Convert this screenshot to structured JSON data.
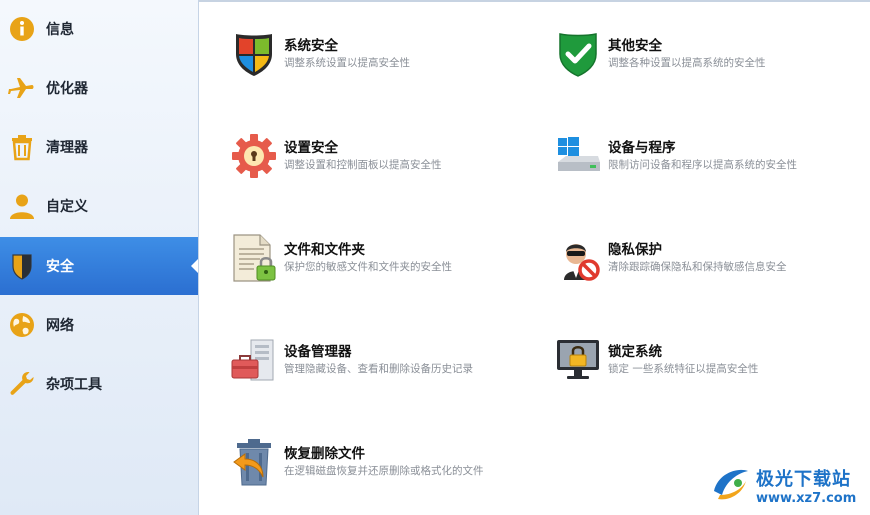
{
  "sidebar": {
    "items": [
      {
        "label": "信息"
      },
      {
        "label": "优化器"
      },
      {
        "label": "清理器"
      },
      {
        "label": "自定义"
      },
      {
        "label": "安全"
      },
      {
        "label": "网络"
      },
      {
        "label": "杂项工具"
      }
    ],
    "active_index": 4
  },
  "main": {
    "tiles": [
      {
        "title": "系统安全",
        "desc": "调整系统设置以提高安全性"
      },
      {
        "title": "其他安全",
        "desc": "调整各种设置以提高系统的安全性"
      },
      {
        "title": "设置安全",
        "desc": "调整设置和控制面板以提高安全性"
      },
      {
        "title": "设备与程序",
        "desc": "限制访问设备和程序以提高系统的安全性"
      },
      {
        "title": "文件和文件夹",
        "desc": "保护您的敏感文件和文件夹的安全性"
      },
      {
        "title": "隐私保护",
        "desc": "清除跟踪确保隐私和保持敏感信息安全"
      },
      {
        "title": "设备管理器",
        "desc": "管理隐藏设备、查看和删除设备历史记录"
      },
      {
        "title": "锁定系统",
        "desc": "锁定 一些系统特征以提高安全性"
      },
      {
        "title": "恢复删除文件",
        "desc": "在逻辑磁盘恢复并还原删除或格式化的文件"
      }
    ]
  },
  "watermark": {
    "name": "极光下载站",
    "url": "www.xz7.com"
  },
  "colors": {
    "active": "#2f7fde",
    "sidebar_bg": "#e6eef8",
    "accent_icon": "#e8a317"
  }
}
